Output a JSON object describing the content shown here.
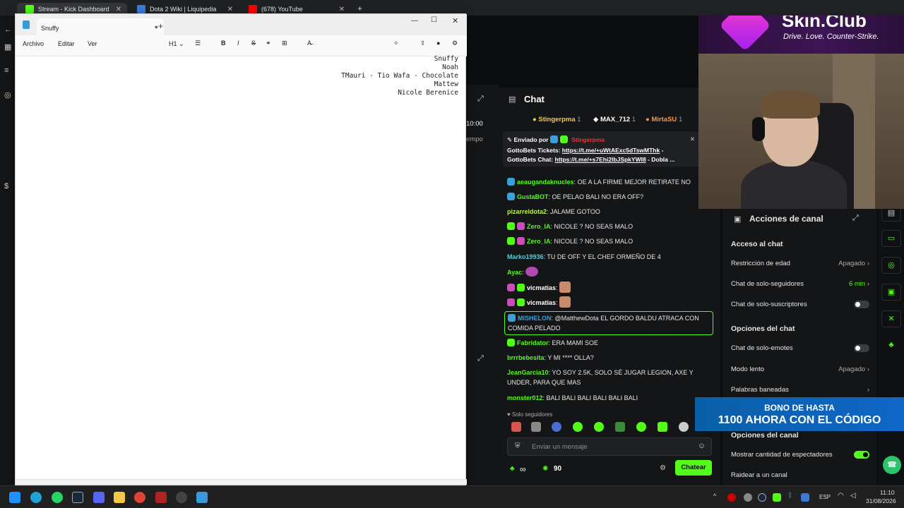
{
  "browser": {
    "tabs": [
      {
        "label": "Stream - Kick Dashboard",
        "active": true
      },
      {
        "label": "Dota 2 Wiki | Liquipedia"
      },
      {
        "label": "(678) YouTube"
      }
    ],
    "new_tab_icon": "plus-icon"
  },
  "notepad": {
    "tab_title": "Snuffy",
    "menu": [
      "Archivo",
      "Editar",
      "Ver"
    ],
    "heading_selector": "H1",
    "lines": [
      "Snuffy",
      "Noah",
      "TMauri - Tio Wafa - Chocolate",
      "Mattew",
      "Nicole Berenice"
    ]
  },
  "dashboard": {
    "timer": "10:00",
    "tiempo_label": "empo"
  },
  "chat": {
    "title": "Chat",
    "top_gifters": [
      {
        "name": "Stingerpma",
        "count": "1",
        "color": "#f2c94c"
      },
      {
        "name": "MAX_712",
        "count": "1",
        "color": "#ffffff"
      },
      {
        "name": "MirtaSU",
        "count": "1",
        "color": "#f2994a"
      }
    ],
    "pinned": {
      "sent_by_label": "Enviado por",
      "sender": "Stingerpma",
      "line1_prefix": "GottoBets Tickets: ",
      "line1_link": "https://t.me/+uWtAExc5dTswMThk",
      "line1_suffix": " -",
      "line2_prefix": "GottoBets Chat: ",
      "line2_link": "https://t.me/+s7Ehi2lbJSpkYWI8",
      "line2_suffix": " - Dobla ..."
    },
    "messages": [
      {
        "user": "aeaugandaknucles",
        "color": "#53fc18",
        "text": "OE A LA FIRME MEJOR RETIRATE NO"
      },
      {
        "user": "GustaBOT",
        "color": "#53fc18",
        "text": "OE PELAO BALI NO ERA OFF?"
      },
      {
        "user": "pizarreldota2",
        "color": "#bdf056",
        "text": "JALAME GOTOO"
      },
      {
        "user": "Zero_IA",
        "color": "#53fc18",
        "text": "NICOLE ? NO SEAS MALO"
      },
      {
        "user": "Zero_IA",
        "color": "#53fc18",
        "text": "NICOLE ? NO SEAS MALO"
      },
      {
        "user": "Marko19936",
        "color": "#4dd0e1",
        "text": "TU DE OFF Y EL CHEF ORMEÑO DE 4"
      },
      {
        "user": "Ayac",
        "color": "#53fc18",
        "text": ""
      },
      {
        "user": "vicmatias",
        "color": "#ffffff",
        "text": ""
      },
      {
        "user": "vicmatias",
        "color": "#ffffff",
        "text": ""
      },
      {
        "user": "MISHELON",
        "color": "#3aa0d9",
        "text": "@MatthewDota EL GORDO BALDU ATRACA CON COMIDA PELADO"
      },
      {
        "user": "Fabridator",
        "color": "#53fc18",
        "text": "ERA MAMI SOE"
      },
      {
        "user": "brrrbebesita",
        "color": "#53fc18",
        "text": "Y MI **** OLLA?"
      },
      {
        "user": "JeanGarcia10",
        "color": "#53fc18",
        "text": "YO SOY 2.5K, SOLO SÉ JUGAR LEGION, AXE Y UNDER, PARA QUE MAS"
      },
      {
        "user": "monster012",
        "color": "#53fc18",
        "text": "BALI BALI BALI BALI BALI BALI"
      }
    ],
    "followers_only_label": "Solo seguidores",
    "input_placeholder": "Enviar un mensaje",
    "infinity": "∞",
    "points": "90",
    "send_label": "Chatear"
  },
  "channel_actions": {
    "title": "Acciones de canal",
    "chat_access_heading": "Acceso al chat",
    "age_restriction": {
      "label": "Restricción de edad",
      "value": "Apagado"
    },
    "followers_only": {
      "label": "Chat de solo-seguidores",
      "value": "6 min"
    },
    "subscribers_only": {
      "label": "Chat de solo-suscriptores",
      "on": false
    },
    "chat_options_heading": "Opciones del chat",
    "emotes_only": {
      "label": "Chat de solo-emotes",
      "on": false
    },
    "slow_mode": {
      "label": "Modo lento",
      "value": "Apagado"
    },
    "banned_words": {
      "label": "Palabras baneadas"
    },
    "channel_options_heading": "Opciones del canal",
    "viewer_count": {
      "label": "Mostrar cantidad de espectadores",
      "on": true
    },
    "raid": {
      "label": "Raidear a un canal"
    }
  },
  "overlay": {
    "brand": "Skin.Club",
    "tagline": "Drive. Love. Counter-Strike.",
    "promo_line1": "BONO DE HASTA",
    "promo_line2": "1100 AHORA CON EL CÓDIGO"
  },
  "taskbar": {
    "lang": "ESP",
    "time": "11:10",
    "date": "31/08/2026"
  }
}
